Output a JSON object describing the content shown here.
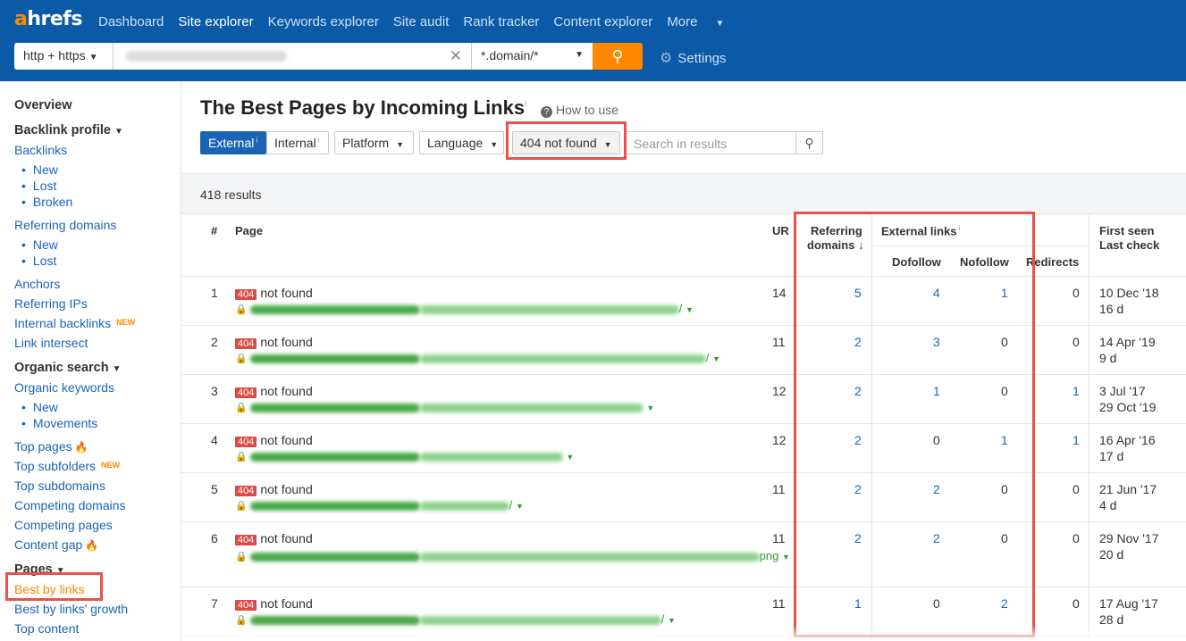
{
  "header": {
    "logo_first": "a",
    "logo_rest": "hrefs",
    "nav": [
      "Dashboard",
      "Site explorer",
      "Keywords explorer",
      "Site audit",
      "Rank tracker",
      "Content explorer",
      "More"
    ],
    "protocol": "http + https",
    "mode": "*.domain/*",
    "settings": "Settings"
  },
  "sidebar": {
    "overview": "Overview",
    "backlink_profile": "Backlink profile",
    "backlinks": "Backlinks",
    "bl_new": "New",
    "bl_lost": "Lost",
    "bl_broken": "Broken",
    "referring_domains": "Referring domains",
    "rd_new": "New",
    "rd_lost": "Lost",
    "anchors": "Anchors",
    "referring_ips": "Referring IPs",
    "internal_backlinks": "Internal backlinks",
    "new_badge": "NEW",
    "link_intersect": "Link intersect",
    "organic_search": "Organic search",
    "organic_keywords": "Organic keywords",
    "ok_new": "New",
    "ok_movements": "Movements",
    "top_pages": "Top pages",
    "top_subfolders": "Top subfolders",
    "top_subdomains": "Top subdomains",
    "competing_domains": "Competing domains",
    "competing_pages": "Competing pages",
    "content_gap": "Content gap",
    "pages": "Pages",
    "best_by_links": "Best by links",
    "best_by_links_growth": "Best by links' growth",
    "top_content": "Top content"
  },
  "main": {
    "title": "The Best Pages by Incoming Links",
    "how_to_use": "How to use",
    "filters": {
      "external": "External",
      "internal": "Internal",
      "platform": "Platform",
      "language": "Language",
      "status": "404 not found",
      "search_placeholder": "Search in results"
    },
    "results_count": "418 results",
    "columns": {
      "index": "#",
      "page": "Page",
      "ur": "UR",
      "referring": "Referring",
      "domains": "domains",
      "external_links": "External links",
      "dofollow": "Dofollow",
      "nofollow": "Nofollow",
      "redirects": "Redirects",
      "first_seen": "First seen",
      "last_check": "Last check"
    },
    "status_badge": "404",
    "status_text": "not found",
    "rows": [
      {
        "idx": "1",
        "ur": "14",
        "rd": "5",
        "dofollow": "4",
        "nofollow": "1",
        "redirects": "0",
        "first_seen": "10 Dec '18",
        "last_check": "16 d",
        "url_tail": "/"
      },
      {
        "idx": "2",
        "ur": "11",
        "rd": "2",
        "dofollow": "3",
        "nofollow": "0",
        "redirects": "0",
        "first_seen": "14 Apr '19",
        "last_check": "9 d",
        "url_tail": "/"
      },
      {
        "idx": "3",
        "ur": "12",
        "rd": "2",
        "dofollow": "1",
        "nofollow": "0",
        "redirects": "1",
        "first_seen": "3 Jul '17",
        "last_check": "29 Oct '19",
        "url_tail": ""
      },
      {
        "idx": "4",
        "ur": "12",
        "rd": "2",
        "dofollow": "0",
        "nofollow": "1",
        "redirects": "1",
        "first_seen": "16 Apr '16",
        "last_check": "17 d",
        "url_tail": ""
      },
      {
        "idx": "5",
        "ur": "11",
        "rd": "2",
        "dofollow": "2",
        "nofollow": "0",
        "redirects": "0",
        "first_seen": "21 Jun '17",
        "last_check": "4 d",
        "url_tail": "/"
      },
      {
        "idx": "6",
        "ur": "11",
        "rd": "2",
        "dofollow": "2",
        "nofollow": "0",
        "redirects": "0",
        "first_seen": "29 Nov '17",
        "last_check": "20 d",
        "url_tail": "png"
      },
      {
        "idx": "7",
        "ur": "11",
        "rd": "1",
        "dofollow": "0",
        "nofollow": "2",
        "redirects": "0",
        "first_seen": "17 Aug '17",
        "last_check": "28 d",
        "url_tail": "/"
      }
    ]
  },
  "colors": {
    "header_bg": "#0a5aa8",
    "accent": "#ff8800",
    "link": "#1a64b6",
    "highlight": "#e8524a",
    "badge_404": "#e04a42",
    "url_green": "#2a9b33"
  }
}
